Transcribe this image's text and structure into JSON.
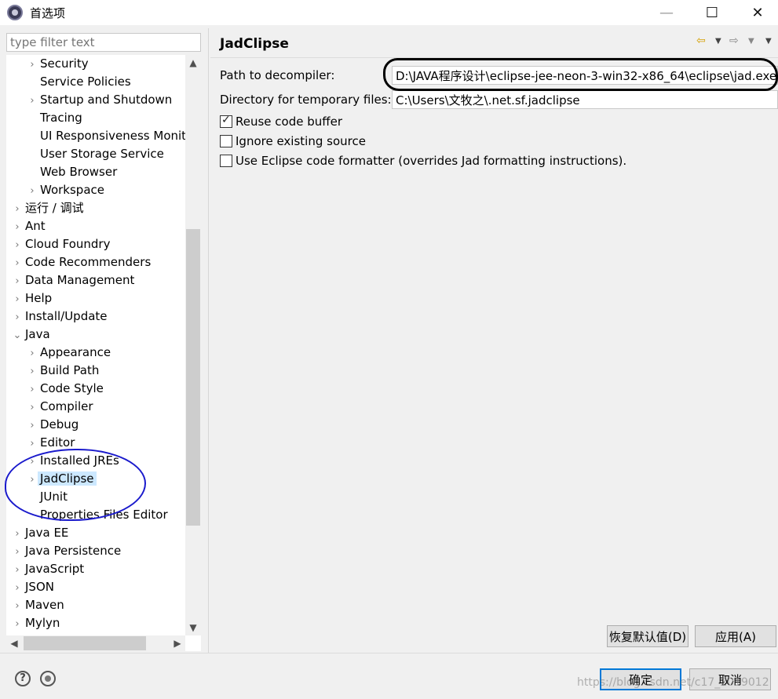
{
  "window": {
    "title": "首选项",
    "minimize_glyph": "—",
    "maximize_glyph": "☐",
    "close_glyph": "✕"
  },
  "filter": {
    "placeholder": "type filter text"
  },
  "tree": {
    "items": [
      {
        "label": "Security",
        "has_children": true,
        "expanded": false,
        "indent": 1
      },
      {
        "label": "Service Policies",
        "has_children": false,
        "expanded": false,
        "indent": 1
      },
      {
        "label": "Startup and Shutdown",
        "has_children": true,
        "expanded": false,
        "indent": 1
      },
      {
        "label": "Tracing",
        "has_children": false,
        "expanded": false,
        "indent": 1
      },
      {
        "label": "UI Responsiveness Monit",
        "has_children": false,
        "expanded": false,
        "indent": 1
      },
      {
        "label": "User Storage Service",
        "has_children": false,
        "expanded": false,
        "indent": 1
      },
      {
        "label": "Web Browser",
        "has_children": false,
        "expanded": false,
        "indent": 1
      },
      {
        "label": "Workspace",
        "has_children": true,
        "expanded": false,
        "indent": 1
      },
      {
        "label": "运行 / 调试",
        "has_children": true,
        "expanded": false,
        "indent": 0
      },
      {
        "label": "Ant",
        "has_children": true,
        "expanded": false,
        "indent": 0
      },
      {
        "label": "Cloud Foundry",
        "has_children": true,
        "expanded": false,
        "indent": 0
      },
      {
        "label": "Code Recommenders",
        "has_children": true,
        "expanded": false,
        "indent": 0
      },
      {
        "label": "Data Management",
        "has_children": true,
        "expanded": false,
        "indent": 0
      },
      {
        "label": "Help",
        "has_children": true,
        "expanded": false,
        "indent": 0
      },
      {
        "label": "Install/Update",
        "has_children": true,
        "expanded": false,
        "indent": 0
      },
      {
        "label": "Java",
        "has_children": true,
        "expanded": true,
        "indent": 0
      },
      {
        "label": "Appearance",
        "has_children": true,
        "expanded": false,
        "indent": 1
      },
      {
        "label": "Build Path",
        "has_children": true,
        "expanded": false,
        "indent": 1
      },
      {
        "label": "Code Style",
        "has_children": true,
        "expanded": false,
        "indent": 1
      },
      {
        "label": "Compiler",
        "has_children": true,
        "expanded": false,
        "indent": 1
      },
      {
        "label": "Debug",
        "has_children": true,
        "expanded": false,
        "indent": 1
      },
      {
        "label": "Editor",
        "has_children": true,
        "expanded": false,
        "indent": 1
      },
      {
        "label": "Installed JREs",
        "has_children": true,
        "expanded": false,
        "indent": 1
      },
      {
        "label": "JadClipse",
        "has_children": true,
        "expanded": false,
        "indent": 1,
        "selected": true
      },
      {
        "label": "JUnit",
        "has_children": false,
        "expanded": false,
        "indent": 1
      },
      {
        "label": "Properties Files Editor",
        "has_children": false,
        "expanded": false,
        "indent": 1
      },
      {
        "label": "Java EE",
        "has_children": true,
        "expanded": false,
        "indent": 0
      },
      {
        "label": "Java Persistence",
        "has_children": true,
        "expanded": false,
        "indent": 0
      },
      {
        "label": "JavaScript",
        "has_children": true,
        "expanded": false,
        "indent": 0
      },
      {
        "label": "JSON",
        "has_children": true,
        "expanded": false,
        "indent": 0
      },
      {
        "label": "Maven",
        "has_children": true,
        "expanded": false,
        "indent": 0
      },
      {
        "label": "Mylyn",
        "has_children": true,
        "expanded": false,
        "indent": 0
      }
    ]
  },
  "page": {
    "title": "JadClipse",
    "path_label": "Path to decompiler:",
    "path_value": "D:\\JAVA程序设计\\eclipse-jee-neon-3-win32-x86_64\\eclipse\\jad.exe",
    "tempdir_label": "Directory for temporary files:",
    "tempdir_value": "C:\\Users\\文牧之\\.net.sf.jadclipse",
    "options": [
      {
        "label": "Reuse code buffer",
        "checked": true
      },
      {
        "label": "Ignore existing source",
        "checked": false
      },
      {
        "label": "Use Eclipse code formatter (overrides Jad formatting instructions).",
        "checked": false
      }
    ]
  },
  "buttons": {
    "restore_defaults": "恢复默认值(D)",
    "apply": "应用(A)",
    "ok": "确定",
    "cancel": "取消"
  },
  "watermark": "https://blog.csdn.net/c17_2019012"
}
